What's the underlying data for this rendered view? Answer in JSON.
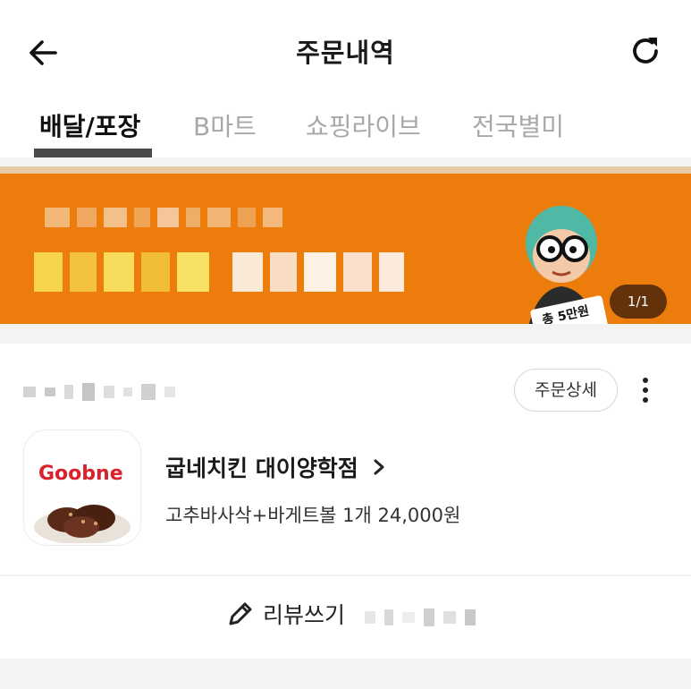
{
  "header": {
    "title": "주문내역",
    "back_icon": "arrow-left-icon",
    "refresh_icon": "refresh-icon"
  },
  "tabs": [
    {
      "label": "배달/포장",
      "active": true
    },
    {
      "label": "B마트",
      "active": false
    },
    {
      "label": "쇼핑라이브",
      "active": false
    },
    {
      "label": "전국별미",
      "active": false
    }
  ],
  "banner": {
    "counter": "1/1",
    "mascot_badge": "총 5만원",
    "background_color": "#ec7d0c"
  },
  "order": {
    "detail_button": "주문상세",
    "store_logo_text": "Goobne",
    "store_name": "굽네치킨 대이양학점",
    "menu_summary": "고추바사삭+바게트볼 1개 24,000원"
  },
  "review": {
    "label": "리뷰쓰기"
  }
}
